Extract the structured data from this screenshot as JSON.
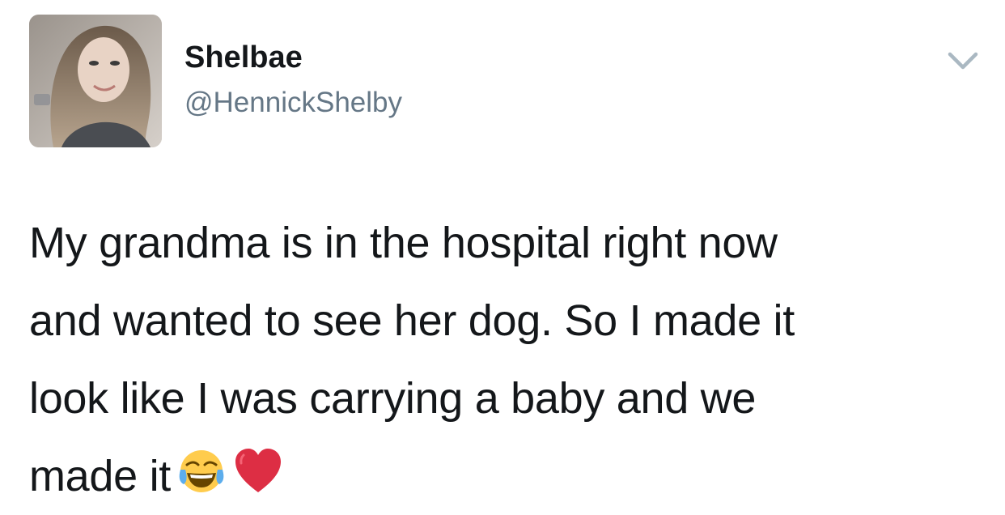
{
  "tweet": {
    "display_name": "Shelbae",
    "handle": "@HennickShelby",
    "text_lines": [
      "My grandma is in the hospital right now",
      "and wanted to see her dog. So I made it",
      "look like I was carrying a baby and we",
      "made it"
    ],
    "emojis": [
      "face-with-tears-of-joy-icon",
      "red-heart-icon"
    ],
    "menu_icon": "chevron-down-icon",
    "avatar": "profile-avatar"
  },
  "colors": {
    "text": "#14171a",
    "handle": "#657786",
    "chevron": "#aab8c2",
    "heart": "#dd2e44",
    "emoji_face": "#ffcc4d",
    "tears": "#5dadec"
  }
}
